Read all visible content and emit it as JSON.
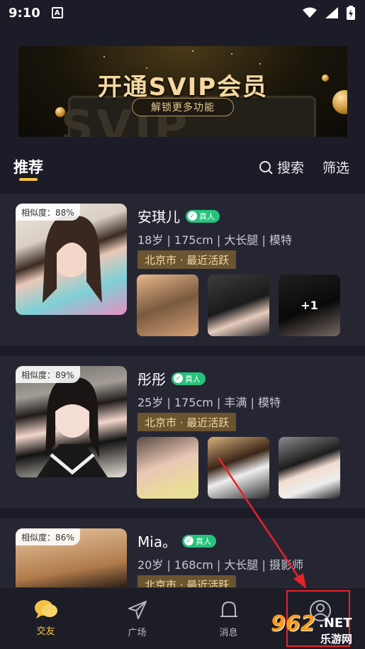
{
  "status_bar": {
    "time": "9:10",
    "notification_letter": "A"
  },
  "banner": {
    "title": "开通SVIP会员",
    "subtitle": "解锁更多功能",
    "bg_text": "SVIP"
  },
  "tabs": {
    "recommend": "推荐",
    "search": "搜索",
    "filter": "筛选"
  },
  "cards": [
    {
      "similarity": "相似度：88%",
      "name": "安琪儿",
      "verified": "真人",
      "info": "18岁 | 175cm | 大长腿 | 模特",
      "location": "北京市 · 最近活跃",
      "more_photos": "+1"
    },
    {
      "similarity": "相似度：89%",
      "name": "彤彤",
      "verified": "真人",
      "info": "25岁 | 175cm | 丰满 | 模特",
      "location": "北京市 · 最近活跃",
      "more_photos": ""
    },
    {
      "similarity": "相似度：86%",
      "name": "Mia。",
      "verified": "真人",
      "info": "20岁 | 168cm | 大长腿 | 摄影师",
      "location": "北京市 · 最近活跃",
      "more_photos": ""
    }
  ],
  "bottom_nav": {
    "items": [
      {
        "label": "交友",
        "icon": "chat-bubbles-icon",
        "active": true
      },
      {
        "label": "广场",
        "icon": "paper-plane-icon",
        "active": false
      },
      {
        "label": "消息",
        "icon": "bell-icon",
        "active": false
      },
      {
        "label": "",
        "icon": "profile-icon",
        "active": false
      }
    ]
  },
  "watermark": {
    "number": "962",
    "suffix": ".NET",
    "chinese": "乐游网"
  },
  "colors": {
    "accent": "#f5c241",
    "verified": "#27c27c",
    "location_bg": "#6a5530",
    "annotation_red": "#e8222b"
  }
}
